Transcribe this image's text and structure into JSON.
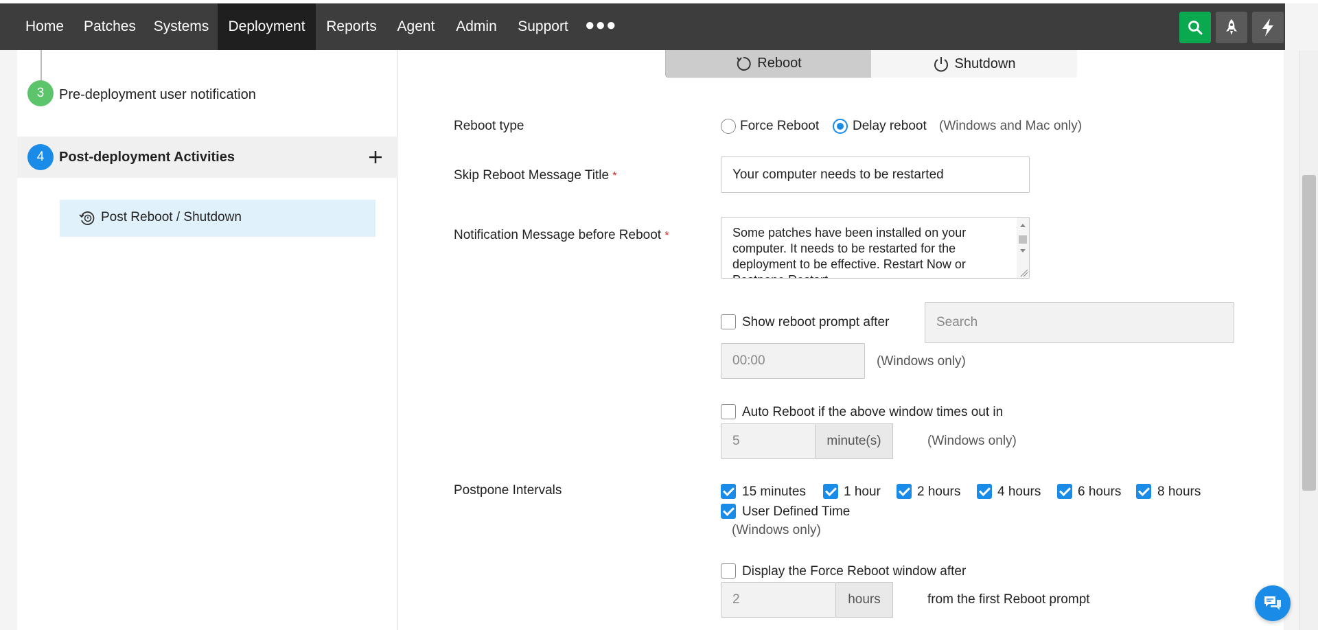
{
  "nav": {
    "items": [
      {
        "label": "Home"
      },
      {
        "label": "Patches"
      },
      {
        "label": "Systems"
      },
      {
        "label": "Deployment",
        "active": true
      },
      {
        "label": "Reports"
      },
      {
        "label": "Agent"
      },
      {
        "label": "Admin"
      },
      {
        "label": "Support"
      }
    ],
    "more_icon": "more-dots-icon",
    "search_icon": "search-icon",
    "rocket_icon": "rocket-icon",
    "bolt_icon": "bolt-icon",
    "accent_color": "#0aa84f"
  },
  "sidebar": {
    "step3": {
      "number": "3",
      "label": "Pre-deployment user notification",
      "color": "#5cc46b"
    },
    "step4": {
      "number": "4",
      "label": "Post-deployment Activities",
      "color": "#1a8ce8"
    },
    "sub_item": {
      "label": "Post Reboot / Shutdown",
      "icon": "reboot-settings-icon"
    }
  },
  "tabs": {
    "reboot": "Reboot",
    "shutdown": "Shutdown"
  },
  "form": {
    "reboot_type": {
      "label": "Reboot type",
      "option_force": "Force Reboot",
      "option_delay": "Delay reboot",
      "selected": "Delay reboot",
      "note": "(Windows and Mac only)"
    },
    "skip_title": {
      "label": "Skip Reboot Message Title",
      "required": "*",
      "value": "Your computer needs to be restarted"
    },
    "notification": {
      "label": "Notification Message before Reboot",
      "required": "*",
      "value": "Some patches have been installed on your computer. It needs to be restarted for the deployment to be effective. Restart Now or Postpone Restart."
    },
    "show_prompt": {
      "label": "Show reboot prompt after",
      "checked": false,
      "search_placeholder": "Search",
      "time_value": "00:00",
      "note": "(Windows only)"
    },
    "auto_reboot": {
      "label": "Auto Reboot if the above window times out in",
      "checked": false,
      "value": "5",
      "unit": "minute(s)",
      "note": "(Windows only)"
    },
    "postpone": {
      "label": "Postpone Intervals",
      "options": [
        {
          "label": "15 minutes",
          "checked": true
        },
        {
          "label": "1 hour",
          "checked": true
        },
        {
          "label": "2 hours",
          "checked": true
        },
        {
          "label": "4 hours",
          "checked": true
        },
        {
          "label": "6 hours",
          "checked": true
        },
        {
          "label": "8 hours",
          "checked": true
        },
        {
          "label": "User Defined Time",
          "checked": true
        }
      ],
      "note": "(Windows only)"
    },
    "force_window": {
      "label": "Display the Force Reboot window after",
      "checked": false,
      "value": "2",
      "unit": "hours",
      "suffix": "from the first Reboot prompt"
    }
  },
  "chat_icon": "chat-icon"
}
